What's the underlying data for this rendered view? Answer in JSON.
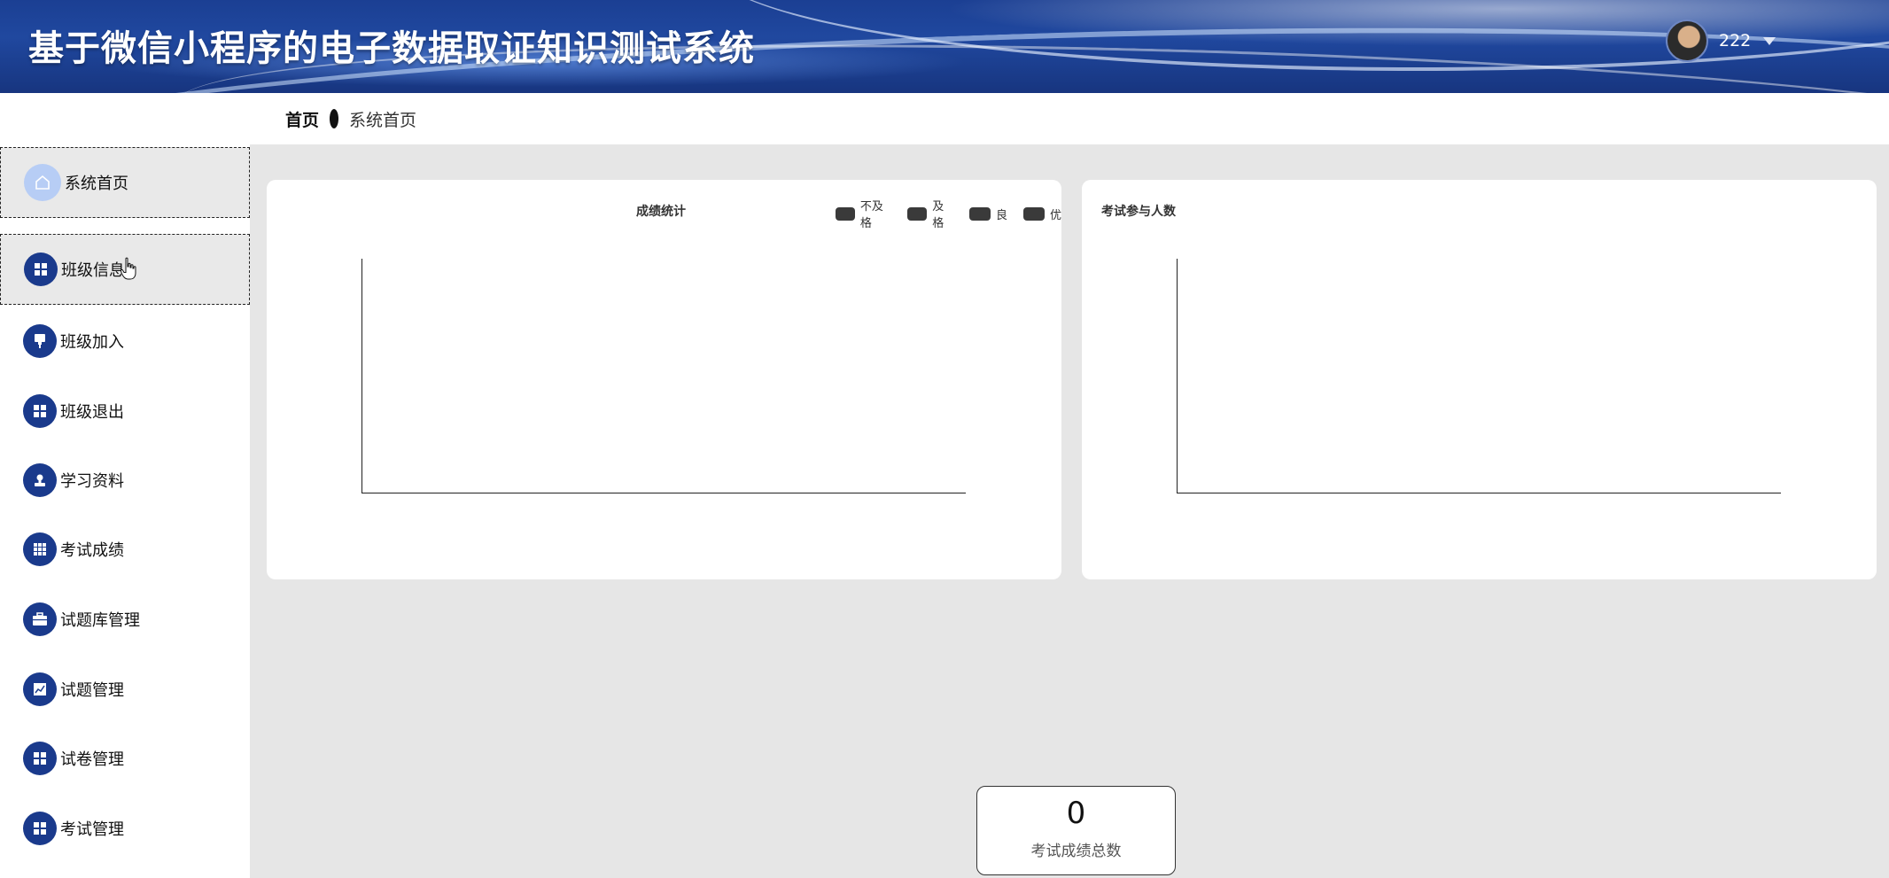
{
  "header": {
    "title": "基于微信小程序的电子数据取证知识测试系统",
    "username": "222"
  },
  "breadcrumb": {
    "home": "首页",
    "current": "系统首页"
  },
  "sidebar": {
    "items": [
      {
        "label": "系统首页",
        "icon": "home-icon"
      },
      {
        "label": "班级信息",
        "icon": "grid-icon"
      },
      {
        "label": "班级加入",
        "icon": "pin-icon"
      },
      {
        "label": "班级退出",
        "icon": "grid-icon"
      },
      {
        "label": "学习资料",
        "icon": "user-stamp-icon"
      },
      {
        "label": "考试成绩",
        "icon": "table-icon"
      },
      {
        "label": "试题库管理",
        "icon": "briefcase-icon"
      },
      {
        "label": "试题管理",
        "icon": "chart-icon"
      },
      {
        "label": "试卷管理",
        "icon": "grid-icon"
      },
      {
        "label": "考试管理",
        "icon": "grid-icon"
      }
    ]
  },
  "charts": {
    "score": {
      "title": "成绩统计",
      "legend": [
        "不及格",
        "及格",
        "良",
        "优"
      ]
    },
    "participants": {
      "title": "考试参与人数"
    }
  },
  "chart_data": [
    {
      "type": "bar",
      "title": "成绩统计",
      "series": [
        {
          "name": "不及格",
          "values": []
        },
        {
          "name": "及格",
          "values": []
        },
        {
          "name": "良",
          "values": []
        },
        {
          "name": "优",
          "values": []
        }
      ],
      "categories": [],
      "legend": "top-right"
    },
    {
      "type": "bar",
      "title": "考试参与人数",
      "categories": [],
      "values": []
    }
  ],
  "stats": {
    "total_value": "0",
    "total_label": "考试成绩总数"
  },
  "colors": {
    "header_blue": "#1b3f93",
    "sidebar_icon": "#1a3a8c",
    "home_icon": "#b7cdf5",
    "legend_swatch": "#3a3a3a"
  }
}
